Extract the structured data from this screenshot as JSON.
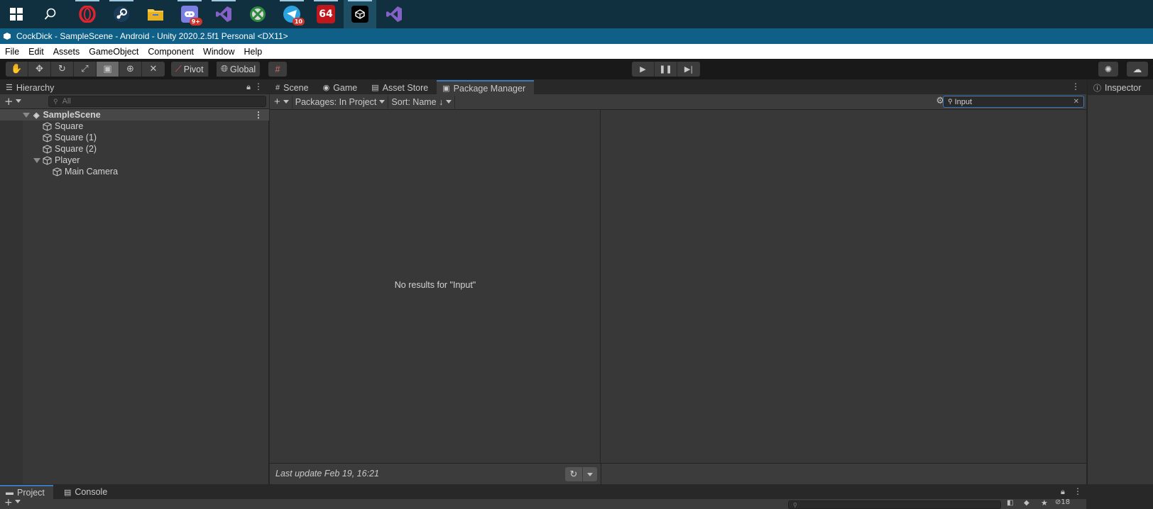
{
  "taskbar": {
    "apps": [
      {
        "name": "start-icon"
      },
      {
        "name": "search-icon"
      },
      {
        "name": "opera-icon"
      },
      {
        "name": "steam-icon"
      },
      {
        "name": "file-explorer-icon"
      },
      {
        "name": "discord-icon",
        "badge": "9+"
      },
      {
        "name": "visual-studio-icon"
      },
      {
        "name": "xbox-icon"
      },
      {
        "name": "telegram-icon",
        "badge": "10"
      },
      {
        "name": "n64-icon",
        "label": "64"
      },
      {
        "name": "unity-icon"
      },
      {
        "name": "visual-studio-icon-2"
      }
    ]
  },
  "window": {
    "title": "CockDick - SampleScene - Android - Unity 2020.2.5f1 Personal <DX11>"
  },
  "menu": {
    "items": [
      "File",
      "Edit",
      "Assets",
      "GameObject",
      "Component",
      "Window",
      "Help"
    ]
  },
  "toolbar": {
    "pivot_label": "Pivot",
    "global_label": "Global"
  },
  "hierarchy": {
    "tab_label": "Hierarchy",
    "search_placeholder": "All",
    "scene": "SampleScene",
    "items": [
      {
        "label": "Square",
        "depth": 1
      },
      {
        "label": "Square (1)",
        "depth": 1
      },
      {
        "label": "Square (2)",
        "depth": 1
      },
      {
        "label": "Player",
        "depth": 1,
        "expanded": true
      },
      {
        "label": "Main Camera",
        "depth": 2
      }
    ]
  },
  "center": {
    "tabs": [
      "Scene",
      "Game",
      "Asset Store",
      "Package Manager"
    ],
    "active_tab": "Package Manager",
    "packages_filter": "Packages: In Project",
    "sort_label": "Sort: Name ↓",
    "search_value": "Input",
    "no_results": "No results for \"Input\"",
    "last_update": "Last update Feb 19, 16:21"
  },
  "inspector": {
    "tab_label": "Inspector"
  },
  "bottom": {
    "tabs": [
      "Project",
      "Console"
    ],
    "hidden_count": "18"
  },
  "colors": {
    "taskbar": "#10303f",
    "titlebar": "#0f5f87",
    "panel": "#383838",
    "accent": "#3a79bb"
  }
}
